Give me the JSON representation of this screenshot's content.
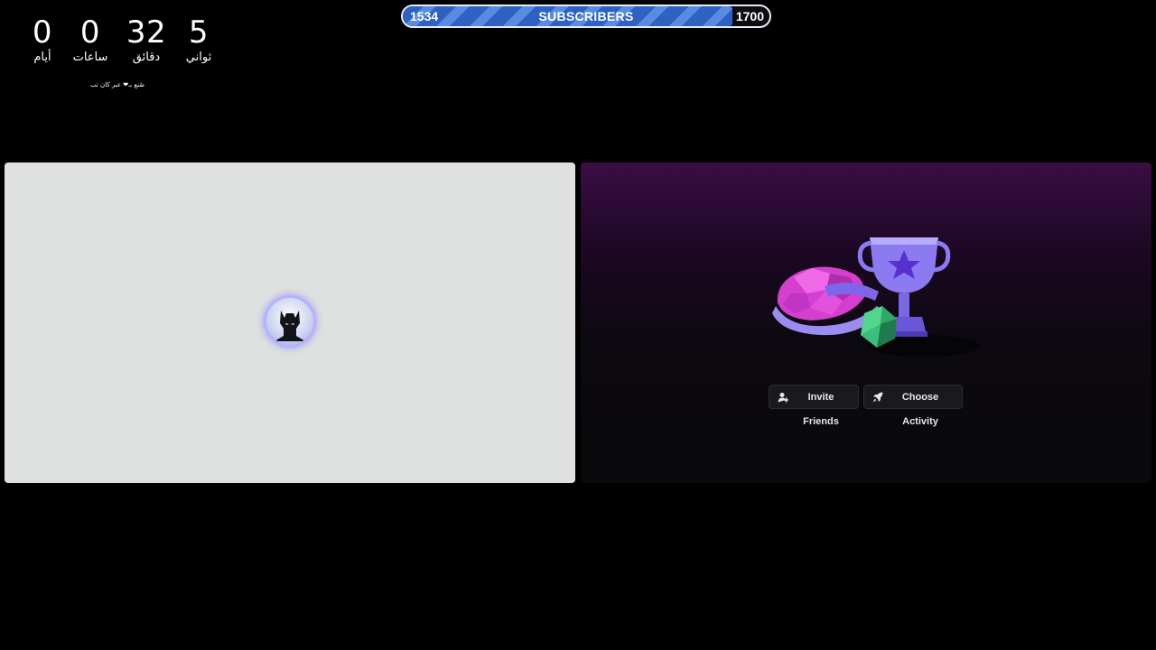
{
  "countdown": {
    "seconds": {
      "value": "5",
      "label": "ثواني"
    },
    "minutes": {
      "value": "32",
      "label": "دقائق"
    },
    "hours": {
      "value": "0",
      "label": "ساعات"
    },
    "days": {
      "value": "0",
      "label": "أيام"
    },
    "credit": "صُنع بـ❤ عبر كان تب"
  },
  "subscribers": {
    "title": "SUBSCRIBERS",
    "current": "1534",
    "goal": "1700",
    "progress_fraction": 0.9
  },
  "left_tile": {
    "avatar_icon": "batman-avatar-icon"
  },
  "right_tile": {
    "illustration_icon": "trophy-dice-illustration-icon",
    "invite_label": "Invite Friends",
    "invite_icon": "person-add-icon",
    "activity_label": "Choose Activity",
    "activity_icon": "rocket-icon"
  },
  "colors": {
    "background": "#000000",
    "bar_fill": "#2e62c2",
    "left_tile": "#dfe1e0",
    "right_tile_top": "#3b0d45"
  }
}
